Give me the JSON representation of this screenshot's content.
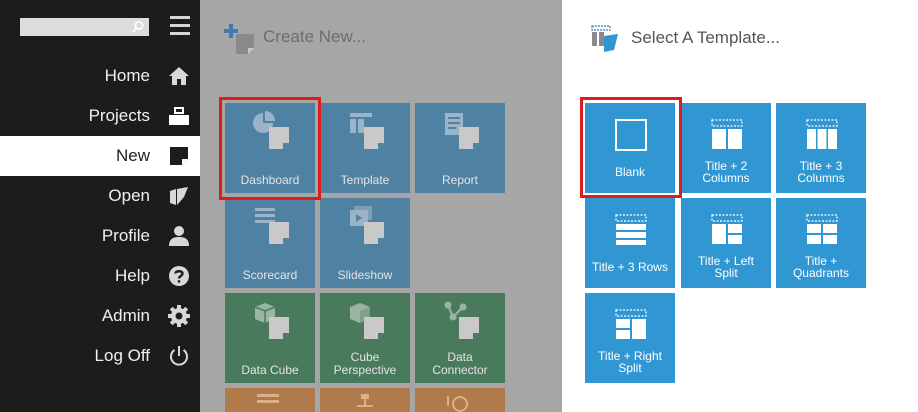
{
  "sidebar": {
    "search": {
      "value": "",
      "placeholder": ""
    },
    "items": [
      {
        "label": "Home",
        "icon": "home-icon"
      },
      {
        "label": "Projects",
        "icon": "briefcase-icon"
      },
      {
        "label": "New",
        "icon": "new-document-icon",
        "active": true
      },
      {
        "label": "Open",
        "icon": "open-folder-icon"
      },
      {
        "label": "Profile",
        "icon": "user-icon"
      },
      {
        "label": "Help",
        "icon": "help-icon"
      },
      {
        "label": "Admin",
        "icon": "gear-icon"
      },
      {
        "label": "Log Off",
        "icon": "power-icon"
      }
    ]
  },
  "create_new": {
    "title": "Create New...",
    "tiles": [
      {
        "label": "Dashboard",
        "icon": "dashboard-icon",
        "color": "#4e81a2"
      },
      {
        "label": "Template",
        "icon": "template-icon",
        "color": "#4e81a2"
      },
      {
        "label": "Report",
        "icon": "report-icon",
        "color": "#4e81a2"
      },
      {
        "label": "Scorecard",
        "icon": "scorecard-icon",
        "color": "#4e81a2"
      },
      {
        "label": "Slideshow",
        "icon": "slideshow-icon",
        "color": "#4e81a2"
      },
      {
        "label": "Data Cube",
        "icon": "data-cube-icon",
        "color": "#4a7a5c"
      },
      {
        "label": "Cube Perspective",
        "icon": "cube-perspective-icon",
        "color": "#4a7a5c"
      },
      {
        "label": "Data Connector",
        "icon": "data-connector-icon",
        "color": "#4a7a5c"
      }
    ]
  },
  "templates": {
    "title": "Select A Template...",
    "tiles": [
      {
        "line1": "Blank",
        "line2": "",
        "icon": "blank-layout-icon"
      },
      {
        "line1": "Title + 2",
        "line2": "Columns",
        "icon": "two-columns-layout-icon"
      },
      {
        "line1": "Title + 3",
        "line2": "Columns",
        "icon": "three-columns-layout-icon"
      },
      {
        "line1": "Title + 3 Rows",
        "line2": "",
        "icon": "three-rows-layout-icon"
      },
      {
        "line1": "Title + Left",
        "line2": "Split",
        "icon": "left-split-layout-icon"
      },
      {
        "line1": "Title +",
        "line2": "Quadrants",
        "icon": "quadrants-layout-icon"
      },
      {
        "line1": "Title + Right",
        "line2": "Split",
        "icon": "right-split-layout-icon"
      }
    ]
  },
  "colors": {
    "sidebar_bg": "#1c1c1c",
    "highlight": "#e01b1b",
    "template_tile": "#3197d3"
  }
}
